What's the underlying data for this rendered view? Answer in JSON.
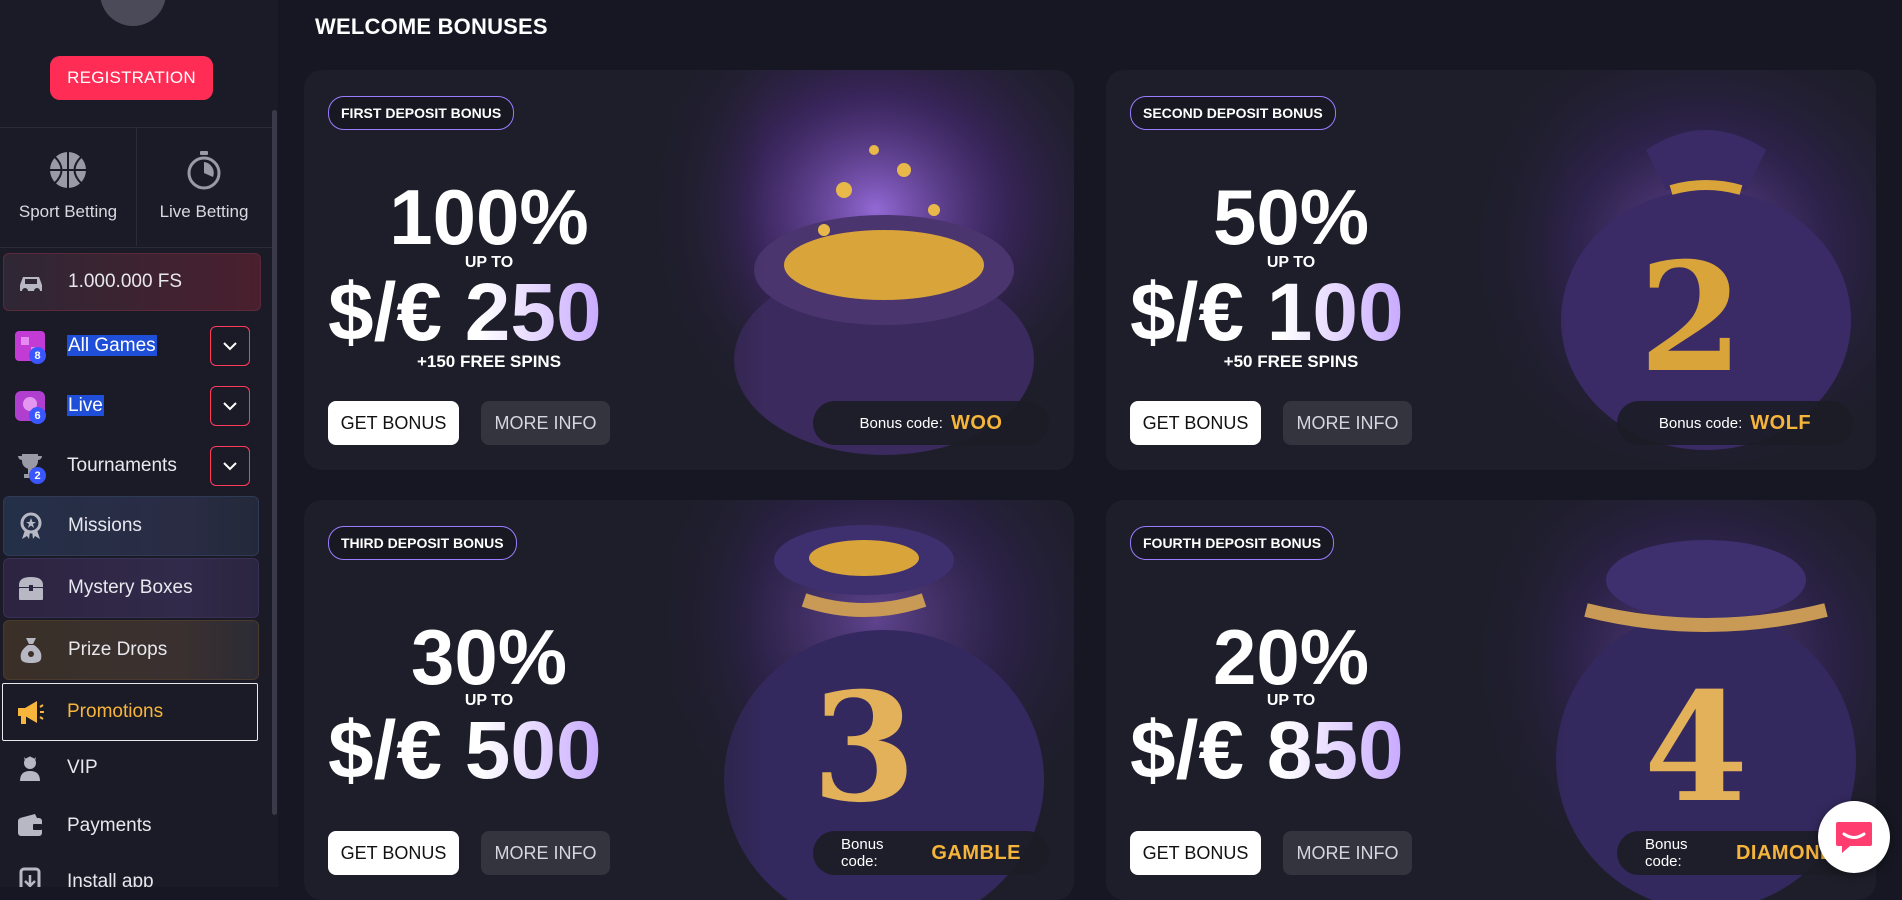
{
  "sidebar": {
    "registration_label": "REGISTRATION",
    "quick_links": [
      {
        "label": "Sport Betting",
        "icon": "basketball-icon"
      },
      {
        "label": "Live Betting",
        "icon": "stopwatch-icon"
      }
    ],
    "fs_promo": {
      "label": "1.000.000 FS",
      "icon": "car-icon"
    },
    "items": [
      {
        "label": "All Games",
        "badge": "8",
        "icon": "games-icon",
        "expandable": true
      },
      {
        "label": "Live",
        "badge": "6",
        "icon": "live-icon",
        "expandable": true
      },
      {
        "label": "Tournaments",
        "badge": "2",
        "icon": "trophy-icon",
        "expandable": true
      },
      {
        "label": "Missions",
        "icon": "medal-icon"
      },
      {
        "label": "Mystery Boxes",
        "icon": "chest-icon"
      },
      {
        "label": "Prize Drops",
        "icon": "money-bag-icon"
      },
      {
        "label": "Promotions",
        "icon": "megaphone-icon",
        "active": true
      },
      {
        "label": "VIP",
        "icon": "vip-icon"
      },
      {
        "label": "Payments",
        "icon": "wallet-icon"
      },
      {
        "label": "Install app",
        "icon": "install-icon"
      }
    ]
  },
  "main": {
    "title": "WELCOME BONUSES",
    "cards": [
      {
        "chip": "FIRST DEPOSIT BONUS",
        "percent": "100%",
        "upto": "UP TO",
        "amount": "$/€ 250",
        "spins": "+150 FREE SPINS",
        "get": "GET BONUS",
        "more": "MORE INFO",
        "code_label": "Bonus code:",
        "code": "WOO",
        "number": ""
      },
      {
        "chip": "SECOND DEPOSIT BONUS",
        "percent": "50%",
        "upto": "UP TO",
        "amount": "$/€ 100",
        "spins": "+50 FREE SPINS",
        "get": "GET BONUS",
        "more": "MORE INFO",
        "code_label": "Bonus code:",
        "code": "WOLF",
        "number": "2"
      },
      {
        "chip": "THIRD DEPOSIT BONUS",
        "percent": "30%",
        "upto": "UP TO",
        "amount": "$/€ 500",
        "spins": "",
        "get": "GET BONUS",
        "more": "MORE INFO",
        "code_label": "Bonus code:",
        "code": "GAMBLE",
        "number": "3"
      },
      {
        "chip": "FOURTH DEPOSIT BONUS",
        "percent": "20%",
        "upto": "UP TO",
        "amount": "$/€ 850",
        "spins": "",
        "get": "GET BONUS",
        "more": "MORE INFO",
        "code_label": "Bonus code:",
        "code": "DIAMOND",
        "number": "4"
      }
    ]
  },
  "colors": {
    "accent": "#ff2d55",
    "code": "#f5b53a",
    "promotions_active": "#f7b53b",
    "background": "#171723"
  }
}
